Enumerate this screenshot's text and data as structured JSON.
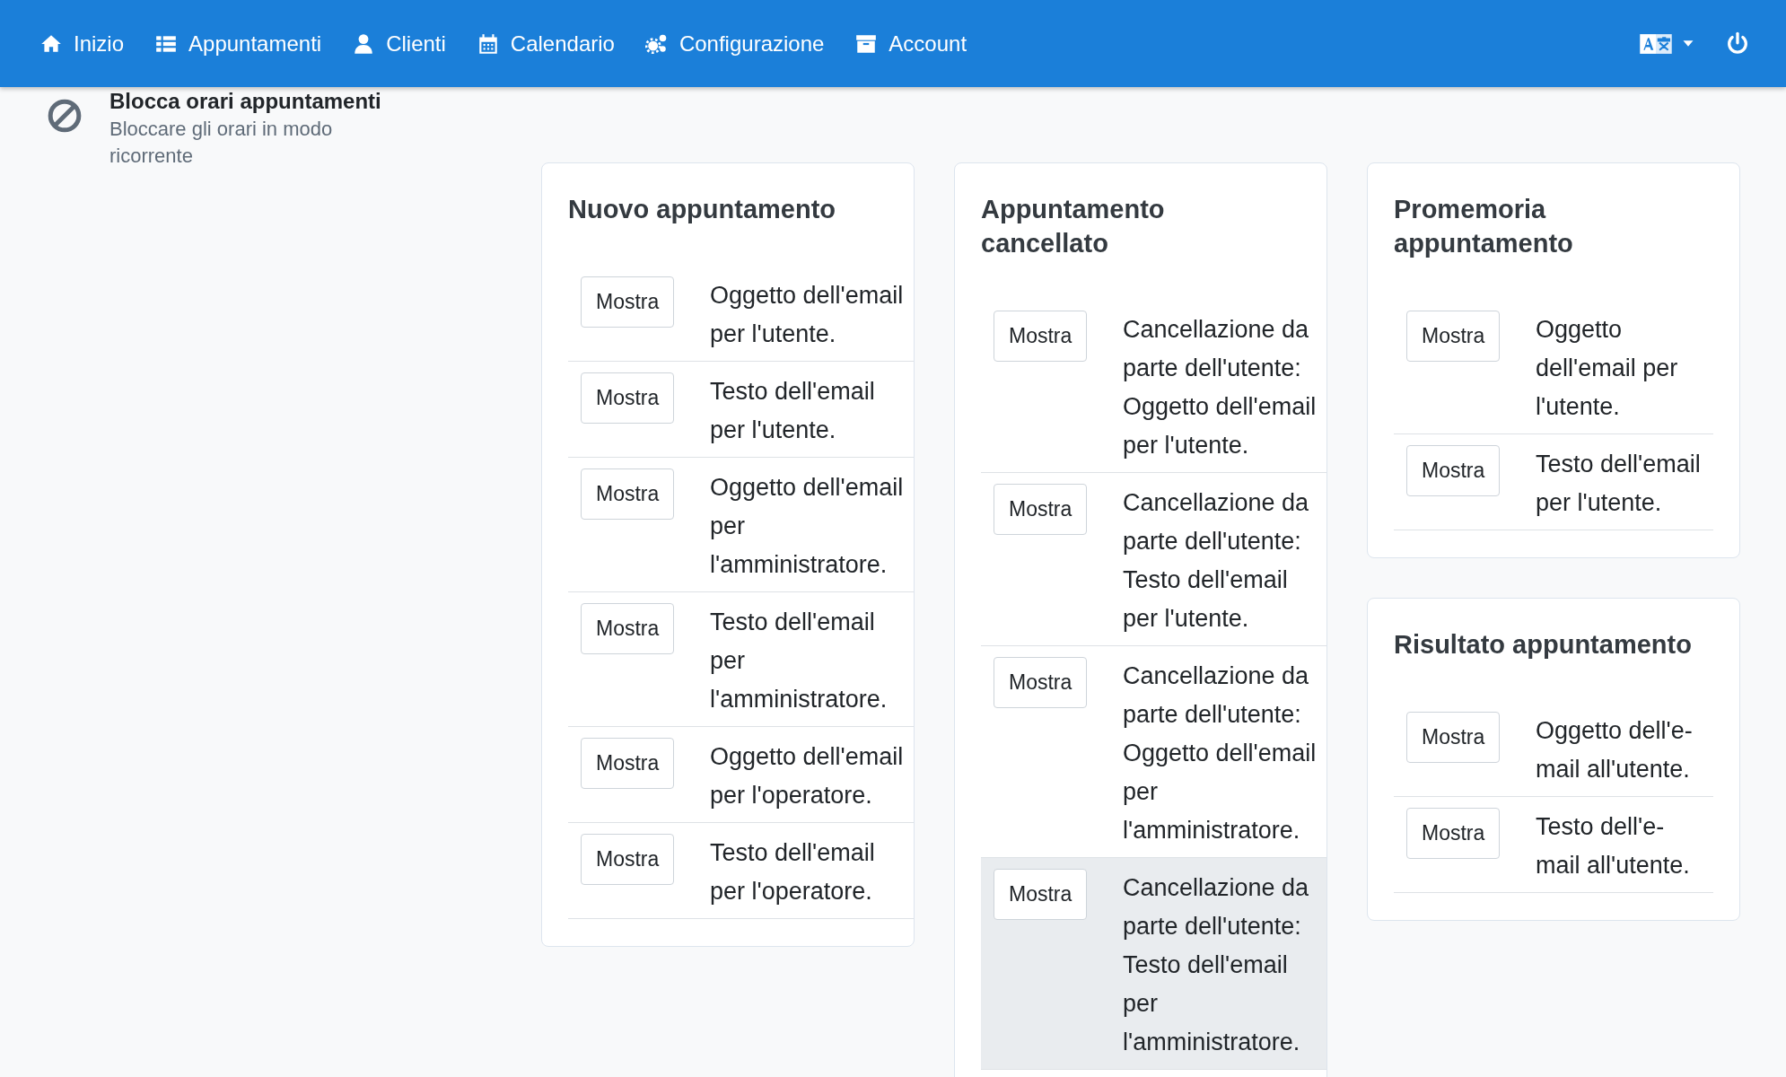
{
  "navbar": {
    "items": [
      {
        "label": "Inizio"
      },
      {
        "label": "Appuntamenti"
      },
      {
        "label": "Clienti"
      },
      {
        "label": "Calendario"
      },
      {
        "label": "Configurazione"
      },
      {
        "label": "Account"
      }
    ]
  },
  "sidebar": {
    "items": [
      {
        "title": "Blocca orari appuntamenti",
        "description": "Bloccare gli orari in modo ricorrente"
      }
    ]
  },
  "columns": [
    [
      {
        "title": "Nuovo appuntamento",
        "rows": [
          {
            "button": "Mostra",
            "text": "Oggetto dell'email per l'utente.",
            "highlighted": false
          },
          {
            "button": "Mostra",
            "text": "Testo dell'email per l'utente.",
            "highlighted": false
          },
          {
            "button": "Mostra",
            "text": "Oggetto dell'email per l'amministratore.",
            "highlighted": false
          },
          {
            "button": "Mostra",
            "text": "Testo dell'email per l'amministratore.",
            "highlighted": false
          },
          {
            "button": "Mostra",
            "text": "Oggetto dell'email per l'operatore.",
            "highlighted": false
          },
          {
            "button": "Mostra",
            "text": "Testo dell'email per l'operatore.",
            "highlighted": false
          }
        ]
      }
    ],
    [
      {
        "title": "Appuntamento cancellato",
        "rows": [
          {
            "button": "Mostra",
            "text": "Cancellazione da parte dell'utente: Oggetto dell'email per l'utente.",
            "highlighted": false
          },
          {
            "button": "Mostra",
            "text": "Cancellazione da parte dell'utente: Testo dell'email per l'utente.",
            "highlighted": false
          },
          {
            "button": "Mostra",
            "text": "Cancellazione da parte dell'utente: Oggetto dell'email per l'amministratore.",
            "highlighted": false
          },
          {
            "button": "Mostra",
            "text": "Cancellazione da parte dell'utente: Testo dell'email per l'amministratore.",
            "highlighted": true
          }
        ]
      }
    ],
    [
      {
        "title": "Promemoria appuntamento",
        "rows": [
          {
            "button": "Mostra",
            "text": "Oggetto dell'email per l'utente.",
            "highlighted": false
          },
          {
            "button": "Mostra",
            "text": "Testo dell'email per l'utente.",
            "highlighted": false
          }
        ]
      },
      {
        "title": "Risultato appuntamento",
        "rows": [
          {
            "button": "Mostra",
            "text": "Oggetto dell'e-mail all'utente.",
            "highlighted": false
          },
          {
            "button": "Mostra",
            "text": "Testo dell'e-mail all'utente.",
            "highlighted": false
          }
        ]
      }
    ]
  ]
}
